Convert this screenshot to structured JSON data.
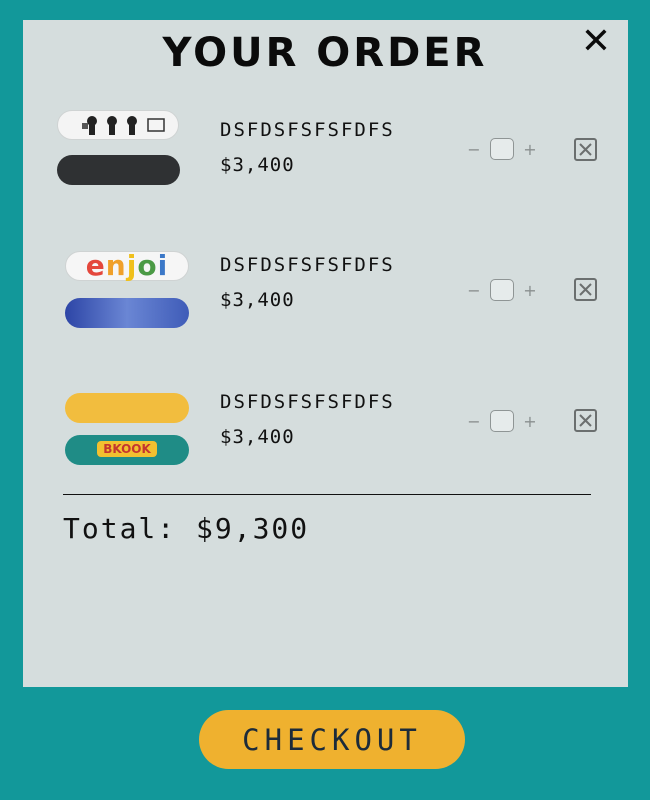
{
  "header": {
    "title": "YOUR ORDER",
    "close_label": "✕"
  },
  "cart": {
    "items": [
      {
        "name": "DSFDSFSFSFDFS",
        "price": "$3,400",
        "quantity_value": "",
        "minus_label": "−",
        "plus_label": "+",
        "image": {
          "top_deck": "#f4f4f4",
          "bottom_deck": "#2f3133"
        }
      },
      {
        "name": "DSFDSFSFSFDFS",
        "price": "$3,400",
        "quantity_value": "",
        "minus_label": "−",
        "plus_label": "+",
        "image": {
          "top_deck": "#f6f6f6",
          "bottom_deck": "#3c58b5",
          "logo_text": "enjoi"
        }
      },
      {
        "name": "DSFDSFSFSFDFS",
        "price": "$3,400",
        "quantity_value": "",
        "minus_label": "−",
        "plus_label": "+",
        "image": {
          "top_deck": "#f2bd3e",
          "bottom_deck": "#1f8c86",
          "logo_text": "BKOOK"
        }
      }
    ]
  },
  "summary": {
    "total_label": "Total:",
    "total_value": "$9,300"
  },
  "footer": {
    "checkout_label": "CHECKOUT"
  },
  "colors": {
    "background": "#12989a",
    "panel": "#d5dddd",
    "checkout_button": "#efb12f",
    "checkout_text": "#1c2b3a"
  }
}
